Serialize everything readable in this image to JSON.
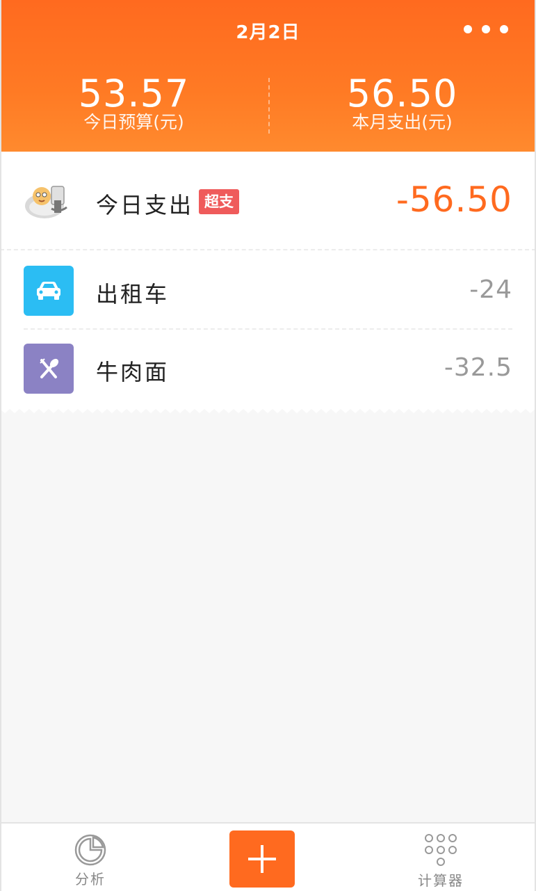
{
  "header": {
    "date": "2月2日",
    "more_icon": "more-dots-icon",
    "today_budget_value": "53.57",
    "today_budget_label": "今日预算(元)",
    "month_expense_value": "56.50",
    "month_expense_label": "本月支出(元)"
  },
  "summary": {
    "title": "今日支出",
    "badge": "超支",
    "amount": "-56.50"
  },
  "items": [
    {
      "label": "出租车",
      "amount": "-24",
      "icon": "car-icon",
      "color": "#2bbdf3"
    },
    {
      "label": "牛肉面",
      "amount": "-32.5",
      "icon": "utensils-icon",
      "color": "#8b82c4"
    }
  ],
  "tabbar": {
    "analysis_label": "分析",
    "add_icon": "plus-icon",
    "calculator_label": "计算器"
  },
  "colors": {
    "accent": "#ff6a1f",
    "badge": "#ef5b5b",
    "amount_gray": "#999999"
  }
}
